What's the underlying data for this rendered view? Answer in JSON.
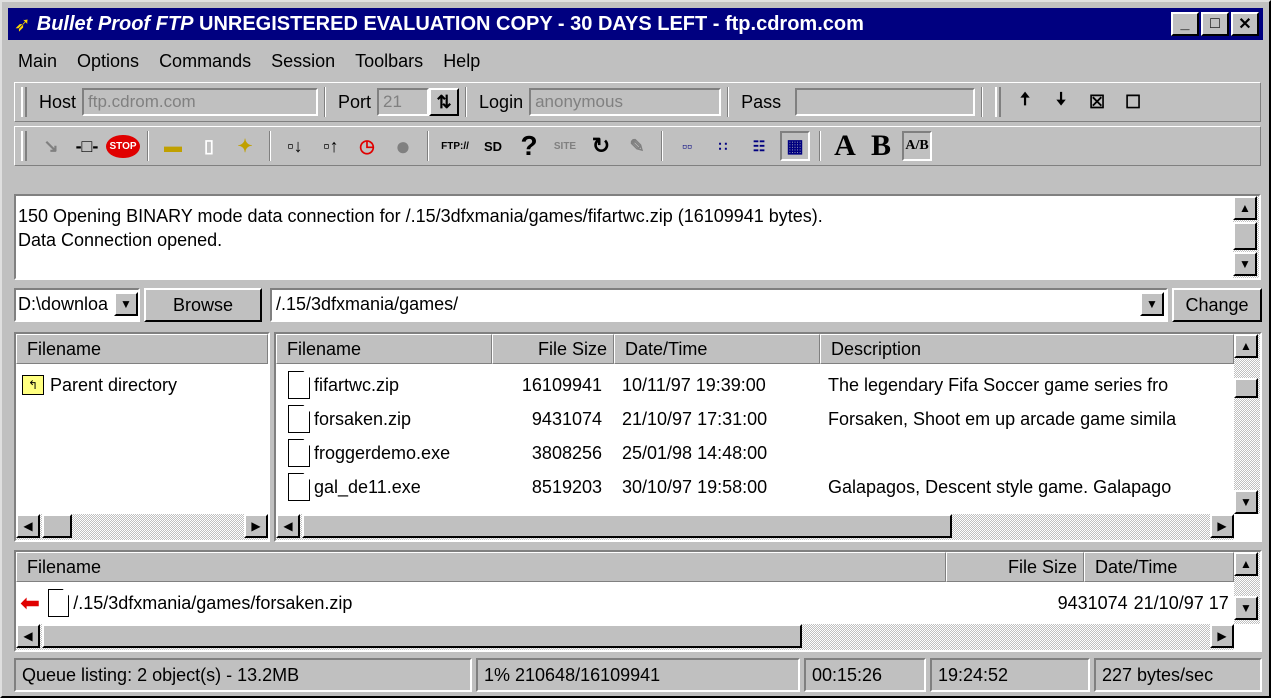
{
  "window": {
    "title_app": "Bullet Proof FTP",
    "title_rest": " UNREGISTERED EVALUATION COPY - 30 DAYS LEFT -  ftp.cdrom.com",
    "min": "_",
    "max": "□",
    "close": "✕"
  },
  "menu": [
    "Main",
    "Options",
    "Commands",
    "Session",
    "Toolbars",
    "Help"
  ],
  "connect": {
    "host_label": "Host",
    "host_value": "ftp.cdrom.com",
    "port_label": "Port",
    "port_value": "21",
    "login_label": "Login",
    "login_value": "anonymous",
    "pass_label": "Pass",
    "pass_value": ""
  },
  "toolbar_text": {
    "ftp": "FTP://",
    "sd": "SD",
    "help": "?",
    "site": "SITE",
    "a": "A",
    "b": "B",
    "ab": "A/B"
  },
  "log": [
    "150 Opening BINARY mode data connection for /.15/3dfxmania/games/fifartwc.zip (16109941 bytes).",
    "Data Connection opened."
  ],
  "local": {
    "drive": "D:\\downloa",
    "browse": "Browse",
    "header": "Filename",
    "items": [
      "Parent directory"
    ]
  },
  "remote": {
    "path": "/.15/3dfxmania/games/",
    "change": "Change",
    "headers": {
      "name": "Filename",
      "size": "File Size",
      "date": "Date/Time",
      "desc": "Description"
    },
    "rows": [
      {
        "name": "fifartwc.zip",
        "size": "16109941",
        "date": "10/11/97 19:39:00",
        "desc": "The legendary Fifa Soccer game series fro"
      },
      {
        "name": "forsaken.zip",
        "size": "9431074",
        "date": "21/10/97 17:31:00",
        "desc": "Forsaken, Shoot em up arcade game simila"
      },
      {
        "name": "froggerdemo.exe",
        "size": "3808256",
        "date": "25/01/98 14:48:00",
        "desc": ""
      },
      {
        "name": "gal_de11.exe",
        "size": "8519203",
        "date": "30/10/97 19:58:00",
        "desc": "Galapagos, Descent style game. Galapago"
      }
    ]
  },
  "queue": {
    "headers": {
      "name": "Filename",
      "size": "File Size",
      "date": "Date/Time"
    },
    "rows": [
      {
        "name": "/.15/3dfxmania/games/forsaken.zip",
        "size": "9431074",
        "date": "21/10/97 17"
      }
    ]
  },
  "status": {
    "queue": "Queue listing: 2 object(s) - 13.2MB",
    "progress": "1% 210648/16109941",
    "elapsed": "00:15:26",
    "remaining": "19:24:52",
    "speed": "227 bytes/sec"
  }
}
